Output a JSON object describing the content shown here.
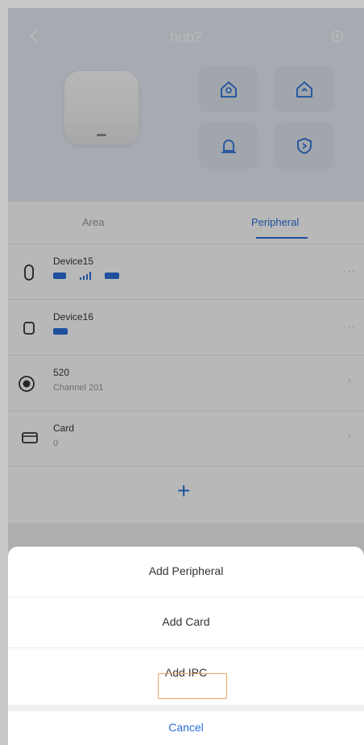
{
  "header": {
    "title": "hub2"
  },
  "tabs": {
    "area": "Area",
    "peripheral": "Peripheral"
  },
  "list": [
    {
      "name": "Device15",
      "sub": ""
    },
    {
      "name": "Device16",
      "sub": ""
    },
    {
      "name": "520",
      "sub": "Channel 201"
    },
    {
      "name": "Card",
      "sub": "0"
    }
  ],
  "list_more": "···",
  "list_arrow": "›",
  "add_symbol": "+",
  "sheet": {
    "add_peripheral": "Add Peripheral",
    "add_card": "Add Card",
    "add_ipc": "Add IPC",
    "cancel": "Cancel"
  },
  "colors": {
    "accent": "#2a6fdb",
    "highlight": "#f0a15a"
  }
}
